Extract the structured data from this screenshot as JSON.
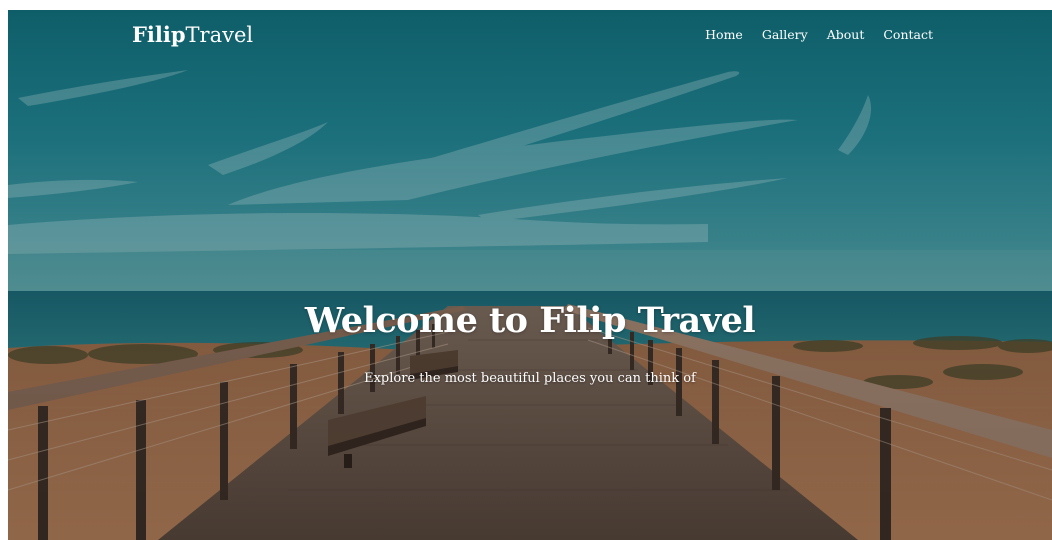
{
  "brand": {
    "bold_part": "Filip",
    "light_part": "Travel"
  },
  "nav": {
    "items": [
      {
        "label": "Home"
      },
      {
        "label": "Gallery"
      },
      {
        "label": "About"
      },
      {
        "label": "Contact"
      }
    ]
  },
  "hero": {
    "title": "Welcome to Filip Travel",
    "subtitle": "Explore the most beautiful places you can think of",
    "background": {
      "sky_top": "#17707c",
      "sky_mid": "#2f8c99",
      "horizon": "#4a9aa3",
      "sea": "#1d6a78",
      "sand": "#b27a55",
      "boardwalk": "#6d5a4c",
      "rail": "#8a6d5b"
    }
  }
}
